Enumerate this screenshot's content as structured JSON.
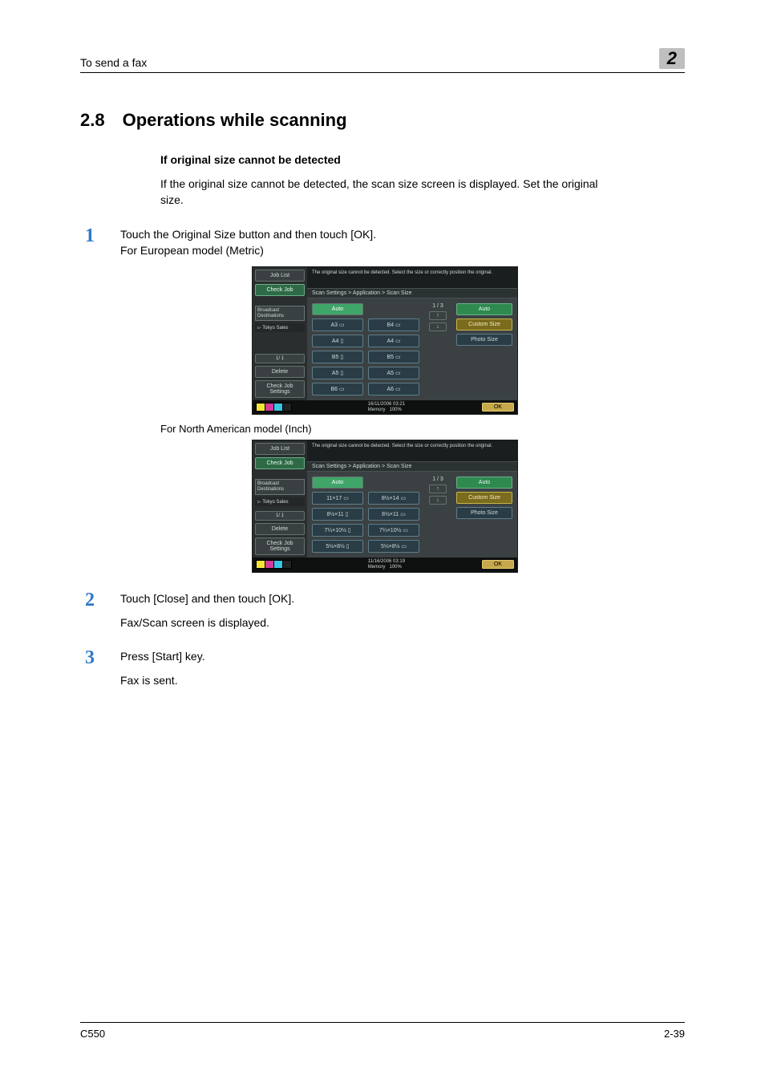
{
  "header": {
    "section_label": "To send a fax",
    "chapter_num": "2"
  },
  "section": {
    "number": "2.8",
    "title": "Operations while scanning"
  },
  "subhead": "If original size cannot be detected",
  "intro": "If the original size cannot be detected, the scan size screen is displayed. Set the original size.",
  "steps": {
    "s1_line1": "Touch the Original Size button and then touch [OK].",
    "s1_line2": "For European model (Metric)",
    "caption_na": "For North American model (Inch)",
    "s2_line1": "Touch [Close] and then touch [OK].",
    "s2_line2": "Fax/Scan screen is displayed.",
    "s3_line1": "Press [Start] key.",
    "s3_line2": "Fax is sent."
  },
  "screenshot_common": {
    "job_list": "Job List",
    "check_job": "Check Job",
    "broadcast": "Broadcast\nDestinations",
    "dest1": "Tokyo Sales",
    "page_count": "1/  1",
    "delete": "Delete",
    "check_job_settings": "Check Job\nSettings",
    "top_msg": "The original size cannot be detected.\nSelect the size or correctly position the\noriginal.",
    "breadcrumb": "Scan Settings > Application > Scan Size",
    "auto": "Auto",
    "pager": "1 / 3",
    "right_auto": "Auto",
    "right_custom": "Custom Size",
    "right_photo": "Photo Size",
    "memory": "Memory",
    "mem_pct": "100%",
    "ok": "OK"
  },
  "screenshot_eu": {
    "datetime": "16/11/2006   03:21",
    "sizes_col1": [
      "A3 ▭",
      "A4 ▯",
      "B5 ▯",
      "A5 ▯",
      "B6 ▭"
    ],
    "sizes_col2": [
      "B4 ▭",
      "A4 ▭",
      "B5 ▭",
      "A5 ▭",
      "A6 ▭"
    ]
  },
  "screenshot_na": {
    "datetime": "11/16/2006   03:19",
    "sizes_col1": [
      "11×17 ▭",
      "8½×11 ▯",
      "7¼×10½ ▯",
      "5½×8½ ▯"
    ],
    "sizes_col2": [
      "8½×14 ▭",
      "8½×11 ▭",
      "7¼×10½ ▭",
      "5½×8½ ▭"
    ]
  },
  "footer": {
    "model": "C550",
    "page": "2-39"
  }
}
